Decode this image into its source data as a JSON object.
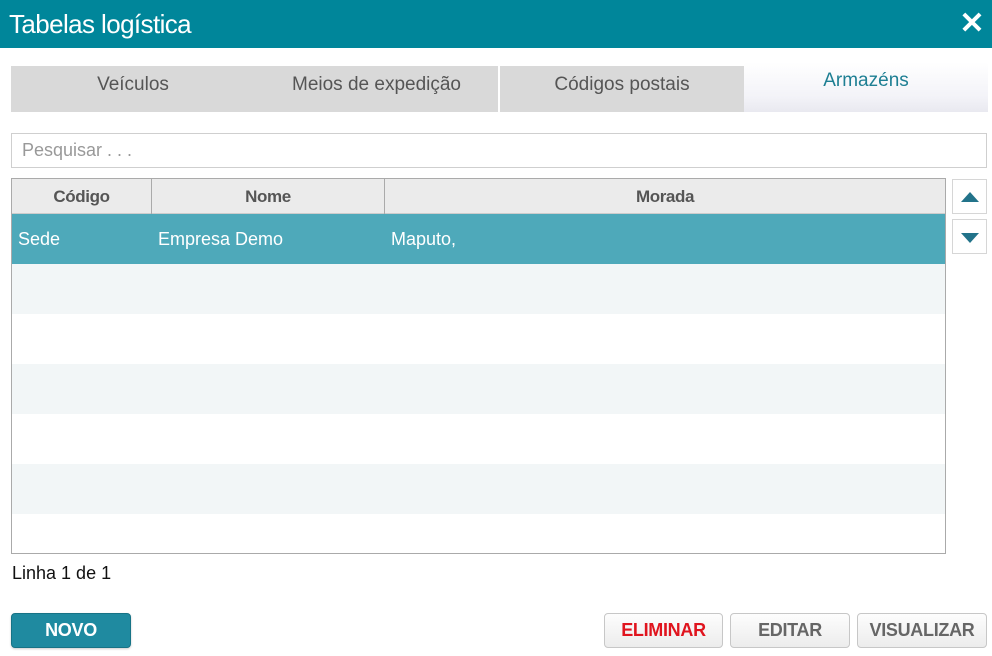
{
  "window": {
    "title": "Tabelas logística",
    "close_icon": "close-icon"
  },
  "tabs": [
    {
      "label": "Veículos",
      "active": false
    },
    {
      "label": "Meios de expedição",
      "active": false
    },
    {
      "label": "Códigos postais",
      "active": false
    },
    {
      "label": "Armazéns",
      "active": true
    }
  ],
  "search": {
    "placeholder": "Pesquisar . . .",
    "value": ""
  },
  "grid": {
    "columns": [
      "Código",
      "Nome",
      "Morada"
    ],
    "rows": [
      {
        "codigo": "Sede",
        "nome": "Empresa Demo",
        "morada": "Maputo,",
        "selected": true
      }
    ],
    "empty_rows": 6
  },
  "scroll_controls": {
    "up_icon": "triangle-up-icon",
    "down_icon": "triangle-down-icon"
  },
  "status": "Linha 1 de 1",
  "buttons": {
    "novo": "NOVO",
    "eliminar": "ELIMINAR",
    "editar": "EDITAR",
    "visualizar": "VISUALIZAR"
  },
  "colors": {
    "header": "#00869a",
    "selected_row": "#4ea9ba",
    "primary_button": "#1f8aa0",
    "danger_text": "#e0141e",
    "active_tab_text": "#1e7f93"
  }
}
